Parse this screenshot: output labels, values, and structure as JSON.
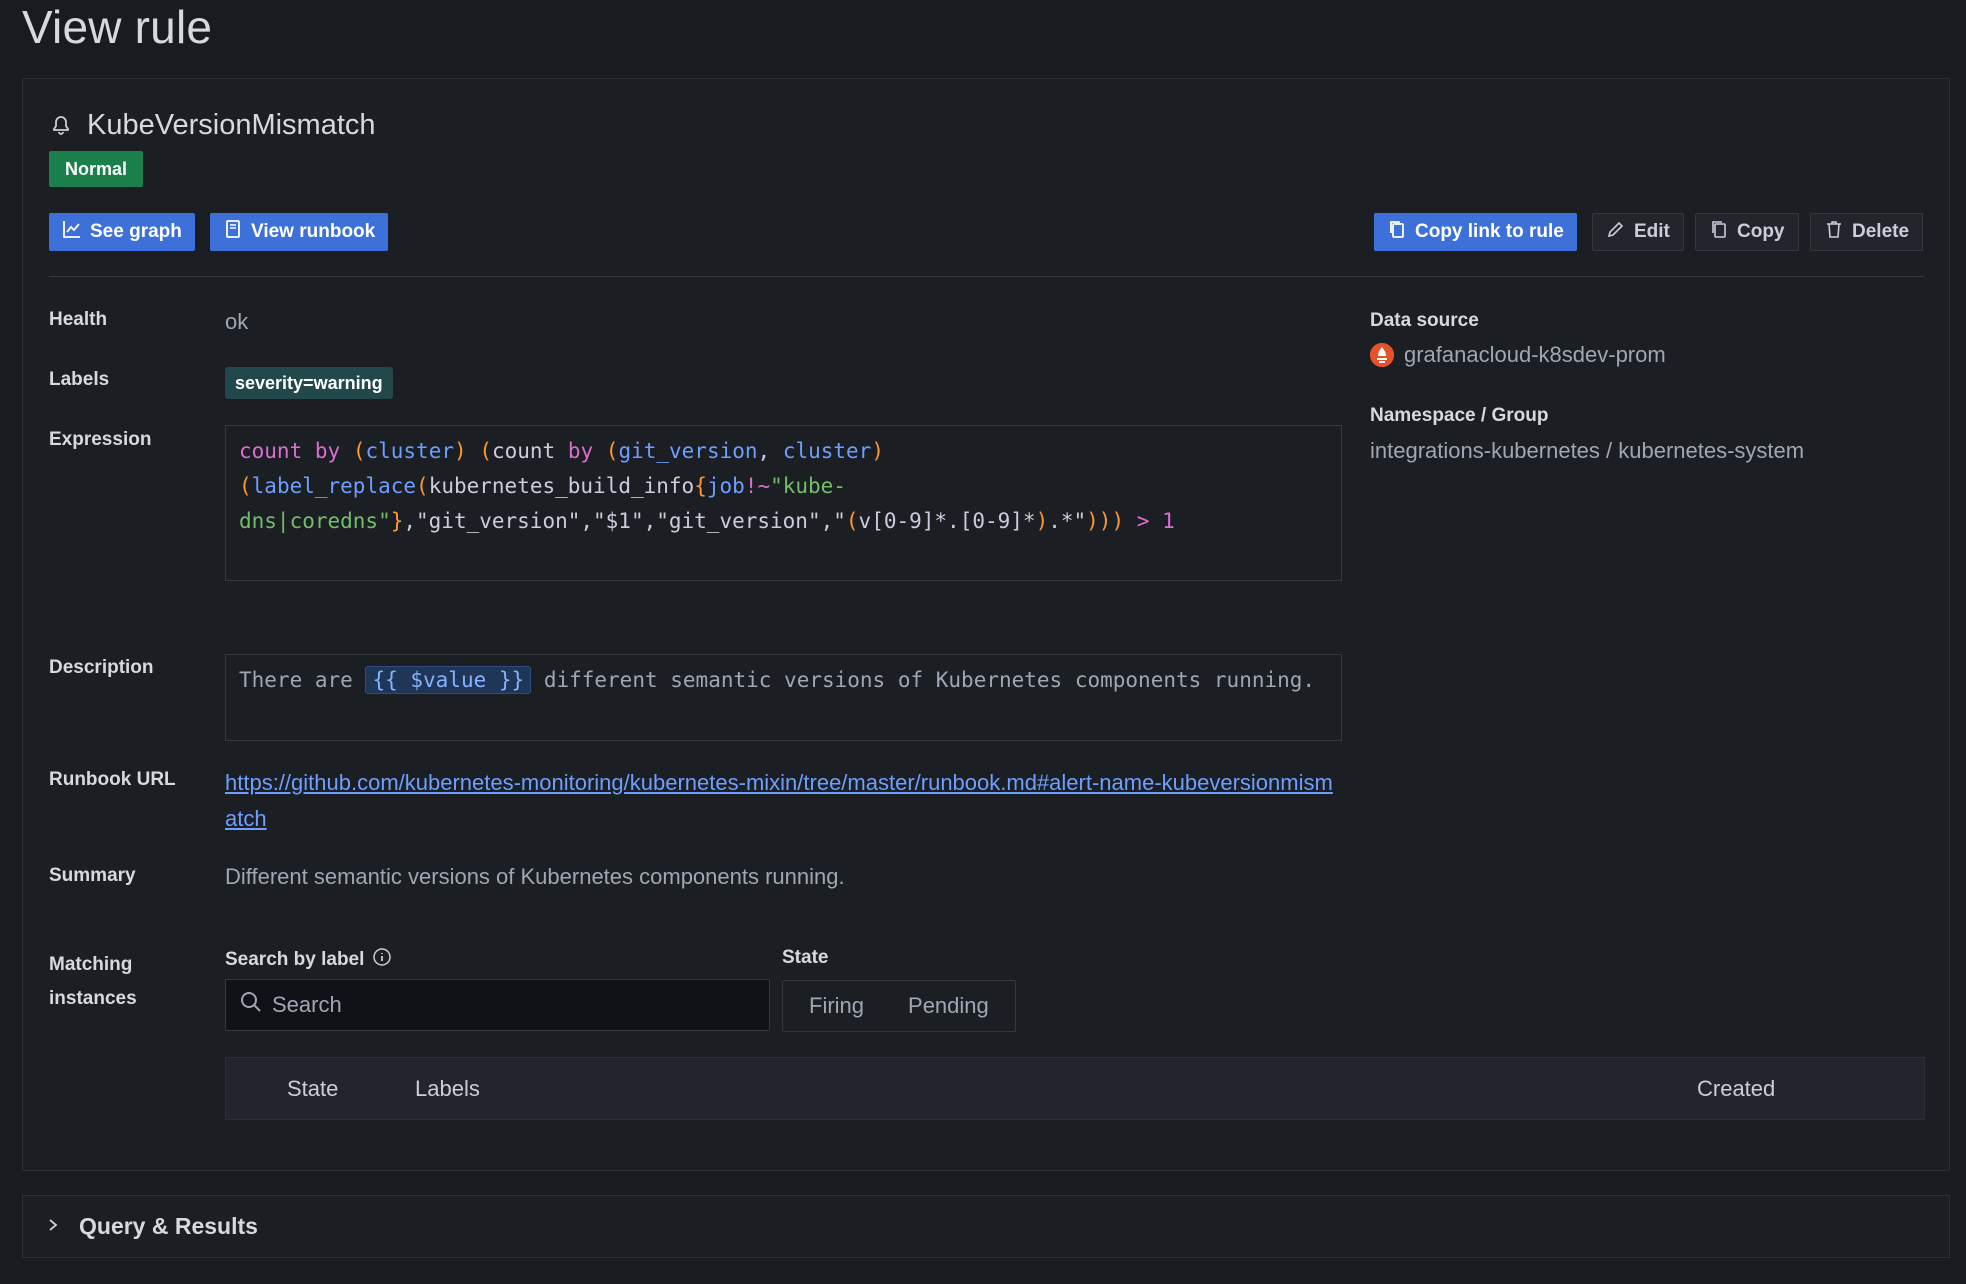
{
  "page": {
    "title": "View rule"
  },
  "rule": {
    "name": "KubeVersionMismatch",
    "status": "Normal",
    "status_color": "#1a7f4b"
  },
  "actions": {
    "see_graph": "See graph",
    "view_runbook": "View runbook",
    "copy_link": "Copy link to rule",
    "edit": "Edit",
    "copy": "Copy",
    "delete": "Delete"
  },
  "details": {
    "health_label": "Health",
    "health_value": "ok",
    "labels_label": "Labels",
    "labels": [
      "severity=warning"
    ],
    "expression_label": "Expression",
    "expression": "count by (cluster) (count by (git_version, cluster) (label_replace(kubernetes_build_info{job!~\"kube-dns|coredns\"},\"git_version\",\"$1\",\"git_version\",\"(v[0-9]*.[0-9]*).*\"))) > 1",
    "description_label": "Description",
    "description_before": "There are",
    "description_template": "{{ $value }}",
    "description_after": "different semantic versions of Kubernetes components running.",
    "runbook_label": "Runbook URL",
    "runbook_url": "https://github.com/kubernetes-monitoring/kubernetes-mixin/tree/master/runbook.md#alert-name-kubeversionmismatch",
    "summary_label": "Summary",
    "summary_value": "Different semantic versions of Kubernetes components running.",
    "matching_label": "Matching instances"
  },
  "sidebar": {
    "datasource_label": "Data source",
    "datasource_value": "grafanacloud-k8sdev-prom",
    "namespace_label": "Namespace / Group",
    "namespace_value": "integrations-kubernetes / kubernetes-system"
  },
  "instances": {
    "search_label": "Search by label",
    "search_placeholder": "Search",
    "state_label": "State",
    "state_options": [
      "Firing",
      "Pending"
    ],
    "columns": [
      "State",
      "Labels",
      "Created"
    ]
  },
  "query_results": {
    "title": "Query & Results"
  },
  "colors": {
    "accent": "#3d71d9",
    "link": "#6e9fff",
    "background": "#181b1f"
  }
}
